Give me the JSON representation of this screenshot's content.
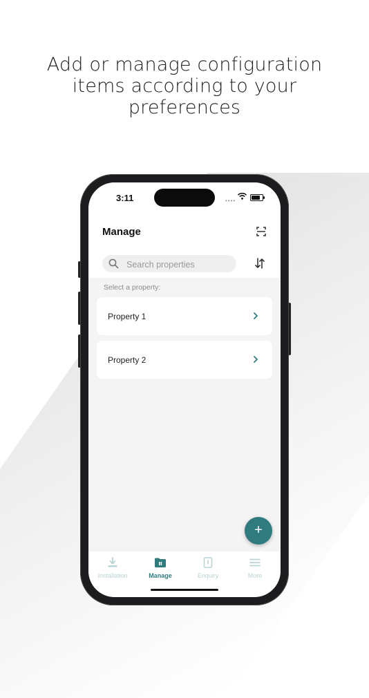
{
  "headline": {
    "line1": "Add or manage configuration",
    "line2": "items according to your",
    "line3": "preferences"
  },
  "status_bar": {
    "time": "3:11",
    "signal": "••••"
  },
  "header": {
    "title": "Manage",
    "scan_icon": "scan-frame-icon"
  },
  "search": {
    "placeholder": "Search properties",
    "value": "",
    "icon": "search-icon"
  },
  "sort_icon": "sort-arrows-icon",
  "section_label": "Select a property:",
  "properties": [
    {
      "label": "Property 1"
    },
    {
      "label": "Property 2"
    }
  ],
  "fab": {
    "label": "+"
  },
  "tabs": [
    {
      "label": "Installation",
      "icon": "download-icon",
      "active": false
    },
    {
      "label": "Manage",
      "icon": "folder-icon",
      "active": true
    },
    {
      "label": "Enquiry",
      "icon": "document-icon",
      "active": false
    },
    {
      "label": "More",
      "icon": "menu-icon",
      "active": false
    }
  ],
  "colors": {
    "accent": "#2f7b7e",
    "inactive_tab": "#b9d4d5",
    "screen_bg": "#f4f4f4"
  }
}
